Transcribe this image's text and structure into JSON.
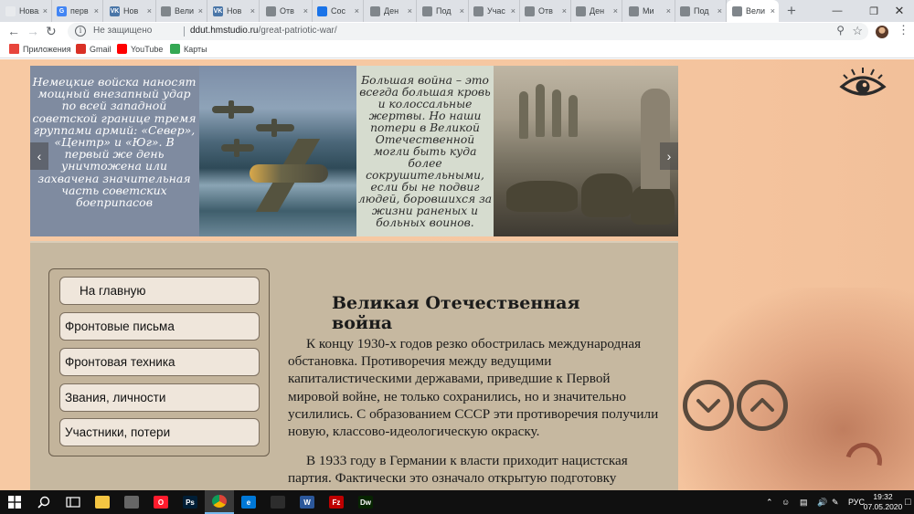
{
  "browser": {
    "tabs": [
      {
        "title": "Новая вкл",
        "fav_color": "#e8eaed",
        "fav_text": ""
      },
      {
        "title": "перв",
        "fav_color": "#4285f4",
        "fav_text": "G"
      },
      {
        "title": "Нов",
        "fav_color": "#4a76a8",
        "fav_text": "VK"
      },
      {
        "title": "Вели",
        "fav_color": "#80868b",
        "fav_text": ""
      },
      {
        "title": "Нов",
        "fav_color": "#4a76a8",
        "fav_text": "VK"
      },
      {
        "title": "Отв",
        "fav_color": "#80868b",
        "fav_text": ""
      },
      {
        "title": "Сос",
        "fav_color": "#1a73e8",
        "fav_text": ""
      },
      {
        "title": "Ден",
        "fav_color": "#80868b",
        "fav_text": ""
      },
      {
        "title": "Под",
        "fav_color": "#80868b",
        "fav_text": ""
      },
      {
        "title": "Учас",
        "fav_color": "#80868b",
        "fav_text": ""
      },
      {
        "title": "Отв",
        "fav_color": "#80868b",
        "fav_text": ""
      },
      {
        "title": "Ден",
        "fav_color": "#80868b",
        "fav_text": ""
      },
      {
        "title": "Ми",
        "fav_color": "#80868b",
        "fav_text": ""
      },
      {
        "title": "Под",
        "fav_color": "#80868b",
        "fav_text": ""
      },
      {
        "title": "Вели",
        "fav_color": "#80868b",
        "fav_text": ""
      }
    ],
    "security_label": "Не защищено",
    "url_host": "ddut.hmstudio.ru",
    "url_path": "/great-patriotic-war/",
    "bookmarks": [
      {
        "label": "Приложения",
        "icon": "apps-icon",
        "color": "#e8453c"
      },
      {
        "label": "Gmail",
        "icon": "gmail-icon",
        "color": "#d93025"
      },
      {
        "label": "YouTube",
        "icon": "youtube-icon",
        "color": "#ff0000"
      },
      {
        "label": "Карты",
        "icon": "maps-icon",
        "color": "#34a853"
      }
    ]
  },
  "banner": {
    "left_text": "Немецкие войска наносят мощный внезапный удар по всей западной советской границе тремя группами армий: «Север», «Центр» и «Юг». В первый же день уничтожена или захвачена значительная часть советских боеприпасов",
    "mid_text": "Большая война – это всегда большая кровь и колоссальные жертвы. Но наши потери в Великой Отечественной могли быть куда более сокрушительными, если бы не подвиг людей, боровшихся за жизни раненых и больных воинов.",
    "prev_arrow": "‹",
    "next_arrow": "›"
  },
  "menu": {
    "items": [
      {
        "label": "На главную"
      },
      {
        "label": "Фронтовые письма"
      },
      {
        "label": "Фронтовая техника"
      },
      {
        "label": "Звания, личности"
      },
      {
        "label": "Участники, потери"
      }
    ]
  },
  "article": {
    "title": "Великая Отечественная война",
    "paragraphs": [
      "К концу 1930-х годов резко обострилась международная обстановка. Противоречия между ведущими капиталистическими державами, приведшие к Первой мировой войне, не только сохранились, но и значительно усилились. С образованием СССР эти противоречия получили новую, классово-идеологическую окраску.",
      "В 1933 году в Германии к власти приходит нацистская партия. Фактически это означало открытую подготовку"
    ]
  },
  "taskbar": {
    "apps": [
      {
        "icon": "file-explorer-icon",
        "color": "#f4c542",
        "text": ""
      },
      {
        "icon": "store-icon",
        "color": "#666666",
        "text": ""
      },
      {
        "icon": "opera-icon",
        "color": "#ff1b2d",
        "text": "O"
      },
      {
        "icon": "photoshop-icon",
        "color": "#001e36",
        "text": "Ps"
      },
      {
        "icon": "chrome-icon",
        "color": "#4285f4",
        "text": ""
      },
      {
        "icon": "edge-icon",
        "color": "#0078d7",
        "text": "e"
      },
      {
        "icon": "photos-icon",
        "color": "#2d2d2d",
        "text": ""
      },
      {
        "icon": "word-icon",
        "color": "#2b579a",
        "text": "W"
      },
      {
        "icon": "filezilla-icon",
        "color": "#bf0000",
        "text": "Fz"
      },
      {
        "icon": "dreamweaver-icon",
        "color": "#072401",
        "text": "Dw"
      }
    ],
    "language": "РУС",
    "time": "19:32",
    "date": "07.05.2020"
  }
}
